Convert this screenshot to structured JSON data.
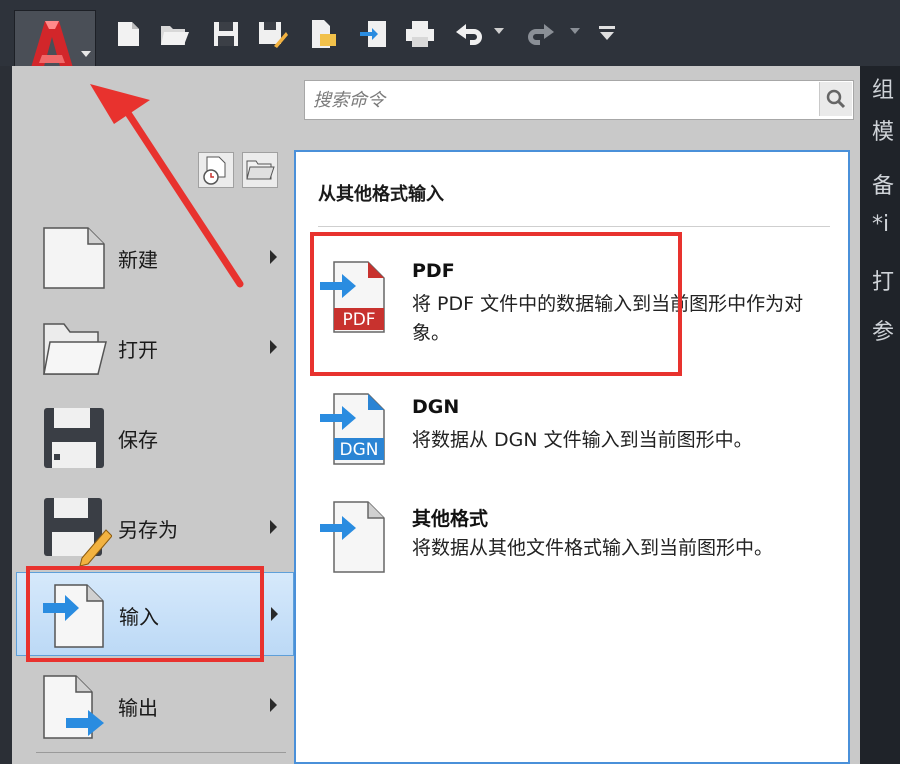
{
  "search": {
    "placeholder": "搜索命令"
  },
  "menu_items": [
    {
      "label": "新建",
      "icon": "new-file-icon",
      "has_submenu": true
    },
    {
      "label": "打开",
      "icon": "open-folder-icon",
      "has_submenu": true
    },
    {
      "label": "保存",
      "icon": "save-icon",
      "has_submenu": false
    },
    {
      "label": "另存为",
      "icon": "save-as-icon",
      "has_submenu": true
    },
    {
      "label": "输入",
      "icon": "import-icon",
      "has_submenu": true,
      "active": true
    },
    {
      "label": "输出",
      "icon": "export-icon",
      "has_submenu": true
    }
  ],
  "submenu": {
    "title": "从其他格式输入",
    "items": [
      {
        "title": "PDF",
        "desc": "将 PDF 文件中的数据输入到当前图形中作为对象。",
        "icon_label": "PDF"
      },
      {
        "title": "DGN",
        "desc": "将数据从 DGN 文件输入到当前图形中。",
        "icon_label": "DGN"
      },
      {
        "title": "其他格式",
        "desc": "将数据从其他文件格式输入到当前图形中。",
        "icon_label": ""
      }
    ]
  },
  "right_strip_glyphs": [
    "组",
    "模",
    "备",
    "*i",
    "打",
    "参"
  ],
  "colors": {
    "accent": "#4a90d9",
    "annotation": "#e8322e",
    "import_arrow": "#2a8ce0",
    "pdf_badge": "#c8322e",
    "dgn_badge": "#2a84d4"
  }
}
